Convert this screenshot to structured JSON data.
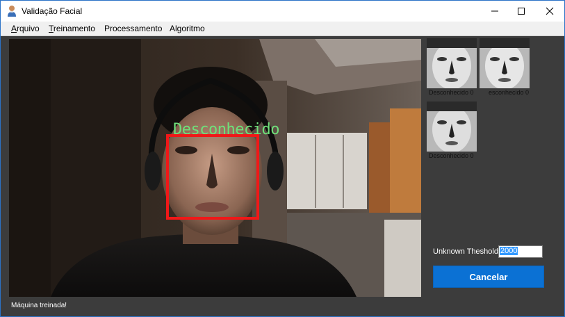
{
  "window": {
    "title": "Validação Facial",
    "minimize_icon": "minimize-icon",
    "maximize_icon": "maximize-icon",
    "close_icon": "close-icon"
  },
  "menu": {
    "items": [
      {
        "label": "Arquivo",
        "mnemonic": "A",
        "rest": "rquivo"
      },
      {
        "label": "Treinamento",
        "mnemonic": "T",
        "rest": "reinamento"
      },
      {
        "label": "Processamento"
      },
      {
        "label": "Algoritmo"
      }
    ]
  },
  "video": {
    "recognized_label": "Desconhecido",
    "box_color": "#f01818",
    "label_color": "#6fe07a"
  },
  "thumbnails": [
    {
      "caption": "Desconhecido 0"
    },
    {
      "caption": "esconhecido 0"
    },
    {
      "caption": "Desconhecido 0"
    }
  ],
  "controls": {
    "threshold_label": "Unknown Theshold:",
    "threshold_value": "2000",
    "cancel_label": "Cancelar",
    "accent": "#0b71d4"
  },
  "status": {
    "text": "Máquina treinada!"
  }
}
